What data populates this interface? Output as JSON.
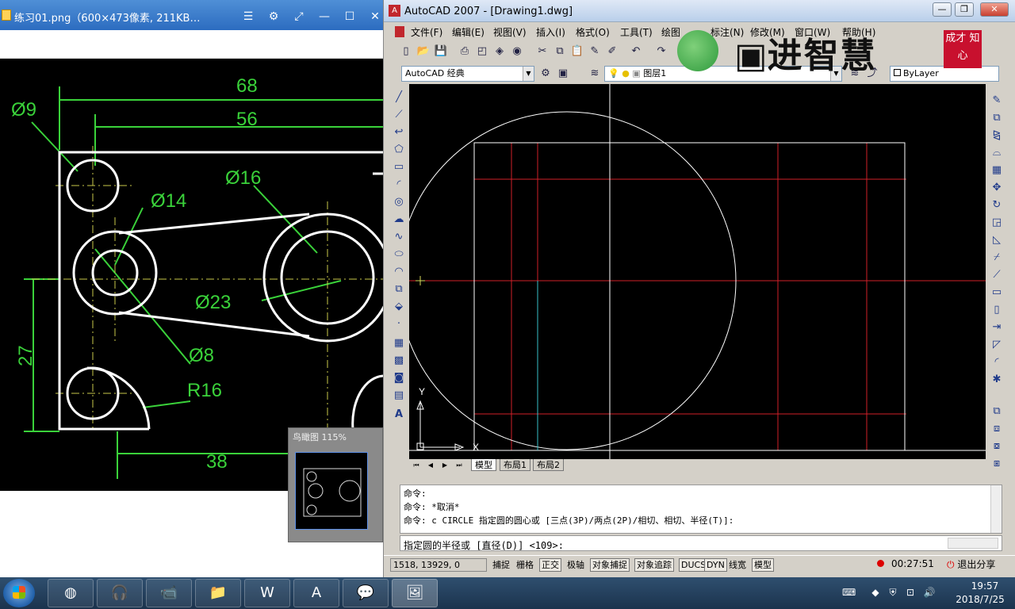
{
  "viewer": {
    "title": "练习01.png（600×473像素, 211KB…",
    "birdseye_label": "鸟瞰图 115%",
    "dims": {
      "d68": "68",
      "d56": "56",
      "phi9": "Ø9",
      "phi16": "Ø16",
      "phi14": "Ø14",
      "phi23": "Ø23",
      "phi8": "Ø8",
      "d27": "27",
      "r16": "R16",
      "d38": "38"
    }
  },
  "acad": {
    "title": "AutoCAD 2007 - [Drawing1.dwg]",
    "menus": [
      "文件(F)",
      "编辑(E)",
      "视图(V)",
      "插入(I)",
      "格式(O)",
      "工具(T)",
      "绘图",
      "标注(N)",
      "修改(M)",
      "窗口(W)",
      "帮助(H)"
    ],
    "workspace": "AutoCAD 经典",
    "layer": "图层1",
    "linetype": "ByLayer",
    "layout_tabs": [
      "模型",
      "布局1",
      "布局2"
    ],
    "ucs_y": "Y",
    "ucs_x": "X",
    "command_history": [
      "命令:",
      "命令: *取消*",
      "命令: c CIRCLE 指定圆的圆心或 [三点(3P)/两点(2P)/相切、相切、半径(T)]:"
    ],
    "command_prompt": "指定圆的半径或 [直径(D)] <109>:",
    "coords": "1518, 13929, 0",
    "status_buttons": [
      "捕捉",
      "栅格",
      "正交",
      "极轴",
      "对象捕捉",
      "对象追踪",
      "DUCS",
      "DYN",
      "线宽",
      "模型"
    ],
    "record_time": "00:27:51",
    "share_label": "退出分享"
  },
  "logo": {
    "text": "进智慧",
    "seal": "成才 知心"
  },
  "taskbar": {
    "time": "19:57",
    "date": "2018/7/25"
  },
  "colors": {
    "cad_background": "#000000",
    "construction_red": "#e0202a",
    "geometry_white": "#ffffff",
    "dimension_green": "#44ee44",
    "centerline_yellow": "#d8d85a"
  }
}
